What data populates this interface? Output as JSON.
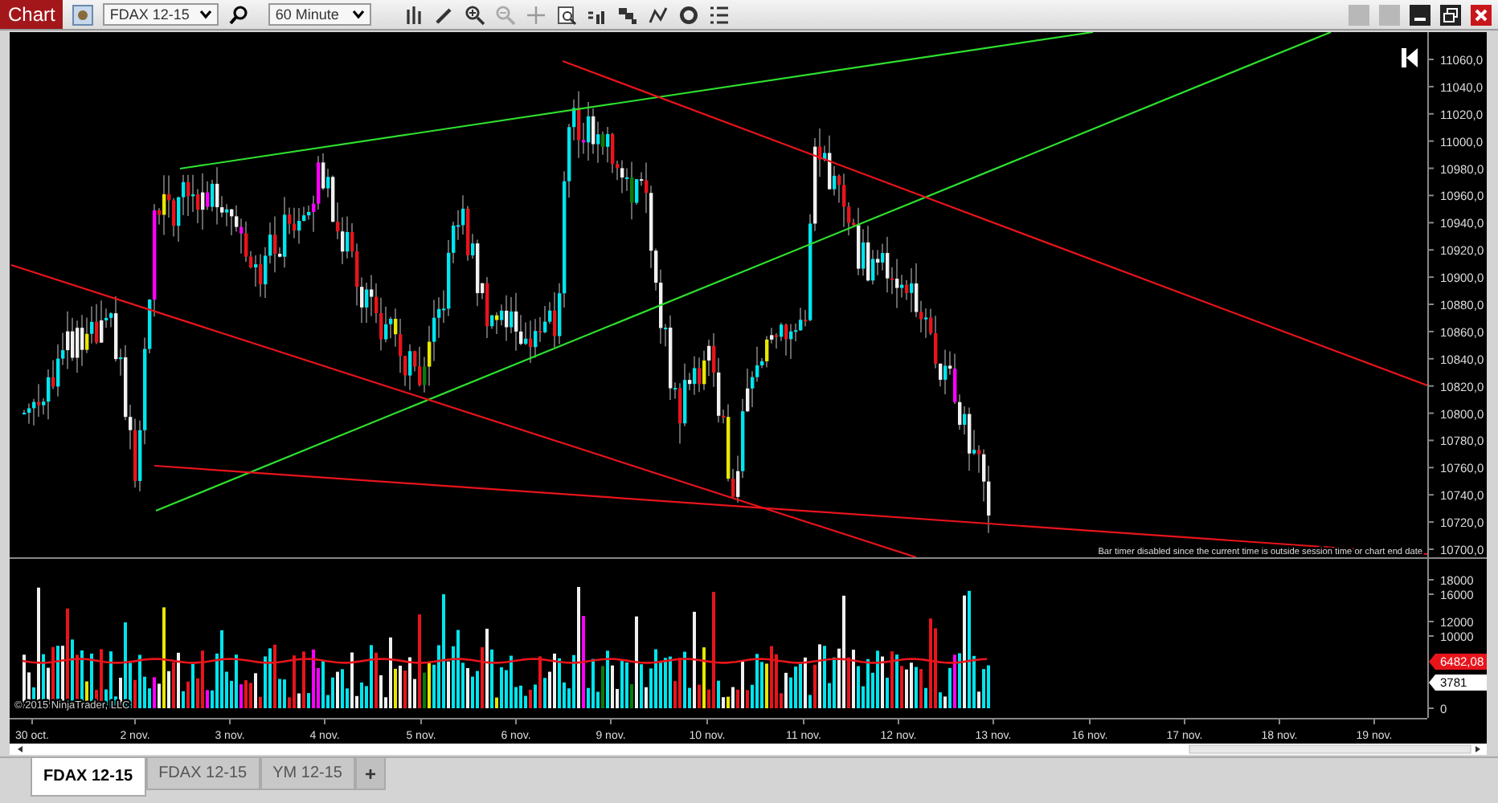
{
  "toolbar": {
    "title": "Chart",
    "instrument": "FDAX 12-15",
    "interval": "60 Minute"
  },
  "price_axis": {
    "ticks": [
      "11060,0",
      "11040,0",
      "11020,0",
      "11000,0",
      "10980,0",
      "10960,0",
      "10940,0",
      "10920,0",
      "10900,0",
      "10880,0",
      "10860,0",
      "10840,0",
      "10820,0",
      "10800,0",
      "10780,0",
      "10760,0",
      "10740,0",
      "10720,0",
      "10700,0"
    ]
  },
  "notice": "Bar timer disabled since the current time is outside session time or chart end date",
  "volume_axis": {
    "ticks": [
      "18000",
      "16000",
      "12000",
      "10000",
      "0"
    ],
    "markers": [
      {
        "text": "6482,08",
        "kind": "average"
      },
      {
        "text": "3781",
        "kind": "volume"
      }
    ]
  },
  "copyright": "© 2015 NinjaTrader, LLC",
  "x_axis": {
    "labels": [
      "30 oct.",
      "2 nov.",
      "3 nov.",
      "4 nov.",
      "5 nov.",
      "6 nov.",
      "9 nov.",
      "10 nov.",
      "11 nov.",
      "12 nov.",
      "13 nov.",
      "16 nov.",
      "17 nov.",
      "18 nov.",
      "19 nov."
    ]
  },
  "tabs": [
    {
      "label": "FDAX 12-15",
      "selected": true
    },
    {
      "label": "FDAX 12-15",
      "selected": false
    },
    {
      "label": "YM 12-15",
      "selected": false
    }
  ],
  "add_tab": "+"
}
